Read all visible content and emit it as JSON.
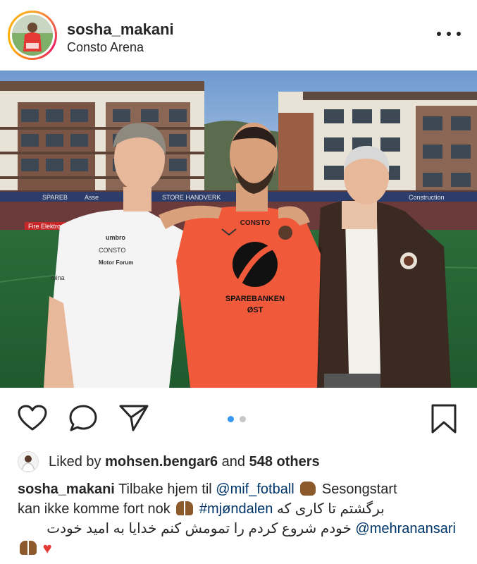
{
  "post": {
    "username": "sosha_makani",
    "location": "Consto Arena"
  },
  "photo": {
    "jersey_brand": "CONSTO",
    "jersey_sponsor_line1": "SPAREBANKEN",
    "jersey_sponsor_line2": "ØST",
    "shirt_logo": "umbro",
    "shirt_text1": "CONSTO",
    "shirt_text2": "Motor Forum",
    "shirt_text3": "mina",
    "board_text1": "Fire Elektro",
    "board_text2": "STORE HANDVERK",
    "board_text3": "Asse",
    "board_text4": "SPAREB",
    "board_text5": "Construction"
  },
  "carousel": {
    "count": 2,
    "active": 1
  },
  "likes": {
    "prefix": "Liked by",
    "liker": "mohsen.bengar6",
    "middle": "and",
    "others": "548 others"
  },
  "caption": {
    "author": "sosha_makani",
    "text1": "Tilbake hjem til",
    "mention1": "@mif_fotball",
    "text2": "Sesongstart",
    "text3": "kan ikke komme fort nok",
    "hashtag": "#mjøndalen",
    "persian1": "برگشتم تا کاری که",
    "mention2": "@mehranansari",
    "persian2": "خودم شروع کردم را تمومش کنم خدایا به امید خودت"
  },
  "colors": {
    "link": "#003569",
    "carousel_active": "#3897f0",
    "carousel_inactive": "#c7c7c7",
    "jersey": "#f05a3a"
  }
}
